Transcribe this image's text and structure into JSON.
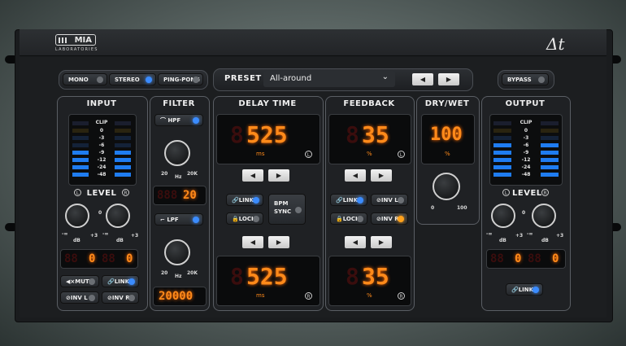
{
  "brand": {
    "name": "MIA",
    "sub": "LABORATORIES",
    "product_symbol": "Δt"
  },
  "mode": {
    "mono": "MONO",
    "stereo": "STEREO",
    "pingpong": "PING-PONG",
    "active": "stereo"
  },
  "preset": {
    "label": "PRESET",
    "value": "All-around",
    "prev": "◀",
    "next": "▶"
  },
  "bypass": "BYPASS",
  "input": {
    "title": "INPUT",
    "clip": "CLIP",
    "scale": [
      "0",
      "-3",
      "-6",
      "-9",
      "-12",
      "-24",
      "-48"
    ],
    "level": "LEVEL",
    "l": "L",
    "r": "R",
    "knob_min": "-∞",
    "knob_max": "+3",
    "db": "dB",
    "knob_zero": "0",
    "readout_l": "0",
    "readout_r": "0",
    "mute": "MUTE",
    "link": "LINK",
    "invl": "INV L",
    "invr": "INV R"
  },
  "filter": {
    "title": "FILTER",
    "hpf": "HPF",
    "lpf": "LPF",
    "min": "20",
    "hz": "Hz",
    "max": "20K",
    "hpf_value": "20",
    "lpf_value": "20000"
  },
  "delay": {
    "title": "DELAY TIME",
    "top_value": "525",
    "bottom_value": "525",
    "unit": "ms",
    "link": "LINK",
    "lock": "LOCK",
    "bpm": "BPM",
    "sync": "SYNC",
    "l": "L",
    "r": "R"
  },
  "feedback": {
    "title": "FEEDBACK",
    "top_value": "35",
    "bottom_value": "35",
    "unit": "%",
    "link": "LINK",
    "lock": "LOCK",
    "invl": "INV L",
    "invr": "INV R"
  },
  "drywet": {
    "title": "DRY/WET",
    "value": "100",
    "unit": "%",
    "min": "0",
    "max": "100"
  },
  "output": {
    "title": "OUTPUT",
    "clip": "CLIP",
    "scale": [
      "0",
      "-3",
      "-6",
      "-9",
      "-12",
      "-24",
      "-48"
    ],
    "level": "LEVEL",
    "l": "L",
    "r": "R",
    "knob_min": "-∞",
    "knob_max": "+3",
    "db": "dB",
    "knob_zero": "0",
    "readout_l": "0",
    "readout_r": "0",
    "link": "LINK"
  },
  "colors": {
    "accent_blue": "#3b8cff",
    "segment_orange": "#ff8a1a",
    "led_orange": "#ffa21c"
  }
}
